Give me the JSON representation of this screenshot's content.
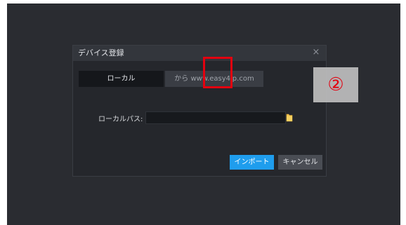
{
  "dialog": {
    "title": "デバイス登録",
    "close_icon": "×",
    "tabs": [
      {
        "label": "ローカル",
        "active": true
      },
      {
        "label": "から www.easy4ip.com",
        "active": false
      }
    ],
    "local_path": {
      "label": "ローカルパス:",
      "value": "",
      "icon": "folder-icon"
    },
    "buttons": {
      "import_label": "インポート",
      "cancel_label": "キャンセル"
    }
  },
  "annotation": {
    "step_marker": "②",
    "highlight_color": "#e3000f"
  },
  "colors": {
    "accent": "#1f9ded",
    "dialog_bg": "#25272c",
    "backdrop_bg": "#2a2c31"
  }
}
